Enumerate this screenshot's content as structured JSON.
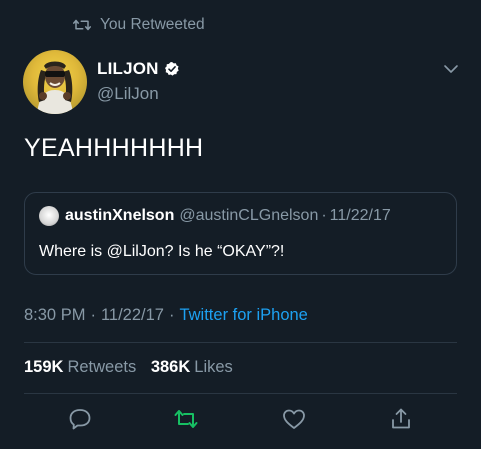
{
  "retweet_context": {
    "label": "You Retweeted",
    "icon": "retweet-icon"
  },
  "author": {
    "display_name": "LILJON",
    "handle": "@LilJon",
    "verified_icon": "verified-badge-icon",
    "avatar": "avatar"
  },
  "tweet": {
    "text": "YEAHHHHHHH"
  },
  "quoted_tweet": {
    "display_name": "austinXnelson",
    "handle": "@austinCLGnelson",
    "separator": "·",
    "date": "11/22/17",
    "text": "Where is @LilJon? Is he “OKAY”?!"
  },
  "meta": {
    "time": "8:30 PM",
    "date": "11/22/17",
    "separator": "·",
    "source": "Twitter for iPhone"
  },
  "stats": {
    "retweets_count": "159K",
    "retweets_label": "Retweets",
    "likes_count": "386K",
    "likes_label": "Likes"
  },
  "actions": {
    "reply_icon": "reply-icon",
    "retweet_icon": "retweet-icon",
    "like_icon": "heart-icon",
    "share_icon": "share-icon",
    "retweet_active_color": "#17bf63"
  },
  "colors": {
    "background": "#141d26",
    "secondary_text": "#8899a6",
    "link": "#1da1f2",
    "border": "#2f3c4a"
  }
}
